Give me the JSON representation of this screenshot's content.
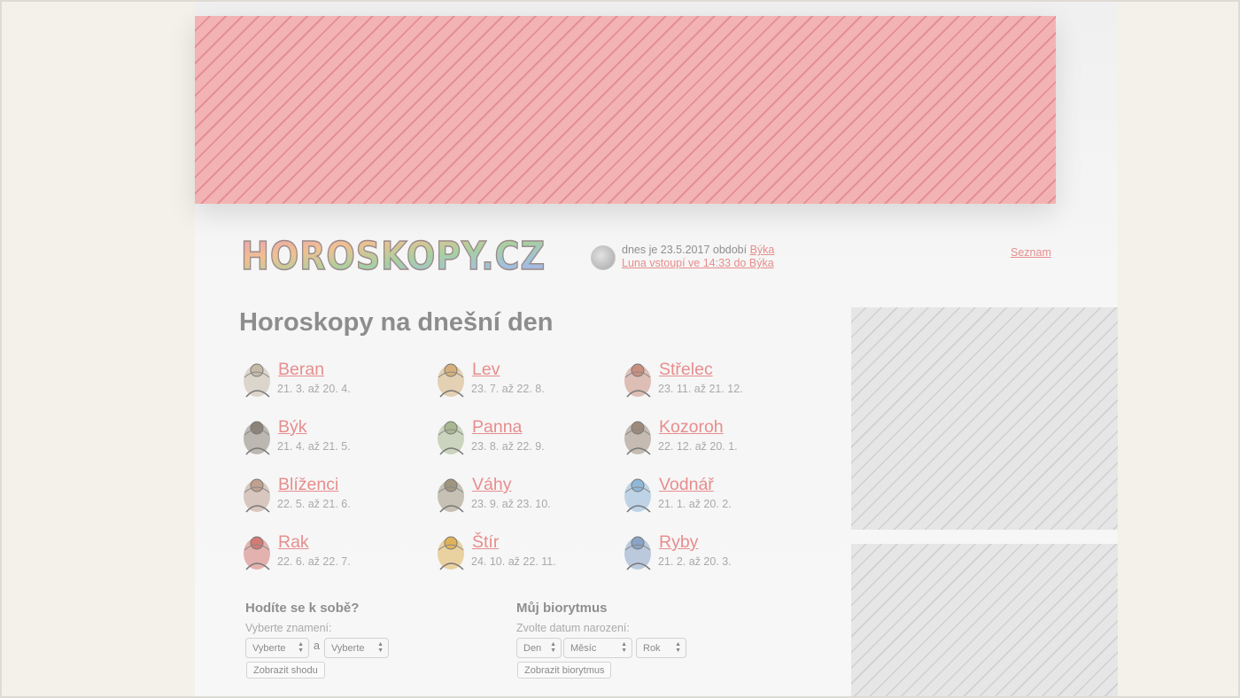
{
  "header": {
    "logo_text": "HOROSKOPY.CZ",
    "today_prefix": "dnes je 23.5.2017 období ",
    "today_sign": "Býka",
    "moon_text": "Luna vstoupí ve 14:33 do Býka",
    "seznam": "Seznam"
  },
  "main": {
    "title": "Horoskopy na dnešní den",
    "signs": [
      {
        "name": "Beran",
        "dates": "21. 3. až 20. 4.",
        "icon": "ram-icon"
      },
      {
        "name": "Lev",
        "dates": "23. 7. až 22. 8.",
        "icon": "lion-icon"
      },
      {
        "name": "Střelec",
        "dates": "23. 11. až 21. 12.",
        "icon": "bow-arrow-icon"
      },
      {
        "name": "Býk",
        "dates": "21. 4. až 21. 5.",
        "icon": "bull-icon"
      },
      {
        "name": "Panna",
        "dates": "23. 8. až 22. 9.",
        "icon": "virgin-icon"
      },
      {
        "name": "Kozoroh",
        "dates": "22. 12. až 20. 1.",
        "icon": "goat-icon"
      },
      {
        "name": "Blíženci",
        "dates": "22. 5. až 21. 6.",
        "icon": "twins-icon"
      },
      {
        "name": "Váhy",
        "dates": "23. 9. až 23. 10.",
        "icon": "scales-icon"
      },
      {
        "name": "Vodnář",
        "dates": "21. 1. až 20. 2.",
        "icon": "water-jug-icon"
      },
      {
        "name": "Rak",
        "dates": "22. 6. až 22. 7.",
        "icon": "crab-icon"
      },
      {
        "name": "Štír",
        "dates": "24. 10. až 22. 11.",
        "icon": "scorpion-icon"
      },
      {
        "name": "Ryby",
        "dates": "21. 2. až 20. 3.",
        "icon": "fish-icon"
      }
    ]
  },
  "compat": {
    "title": "Hodíte se k sobě?",
    "label": "Vyberte znamení:",
    "select1": "Vyberte",
    "and": "a",
    "select2": "Vyberte",
    "button": "Zobrazit shodu"
  },
  "bio": {
    "title": "Můj biorytmus",
    "label": "Zvolte datum narození:",
    "day": "Den",
    "month": "Měsíc",
    "year": "Rok",
    "button": "Zobrazit biorytmus"
  },
  "colors": {
    "link": "#e78d8d",
    "ad_top": "#f3b3b4",
    "ad_side": "#e6e6e6"
  }
}
